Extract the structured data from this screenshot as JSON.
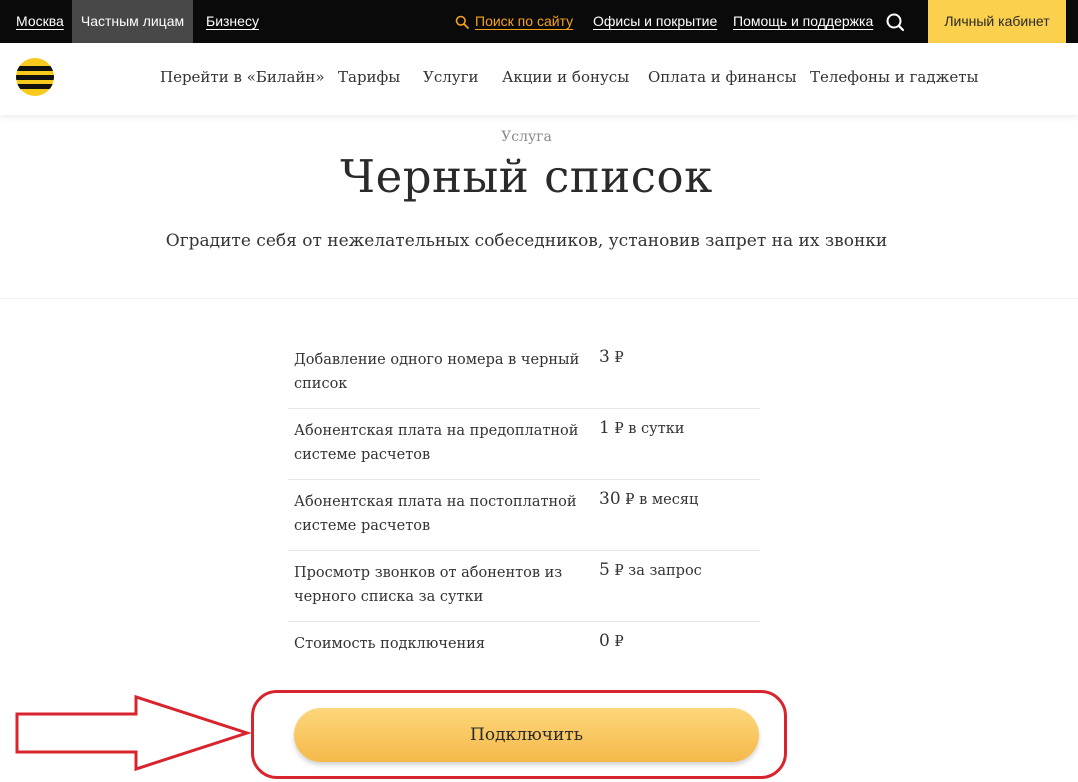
{
  "topbar": {
    "city": "Москва",
    "private": "Частным лицам",
    "business": "Бизнесу",
    "search": "Поиск по сайту",
    "offices": "Офисы и покрытие",
    "help": "Помощь и поддержка",
    "cabinet": "Личный кабинет"
  },
  "nav": {
    "items": [
      "Перейти в «Билайн»",
      "Тарифы",
      "Услуги",
      "Акции и бонусы",
      "Оплата и финансы",
      "Телефоны и гаджеты"
    ]
  },
  "hero": {
    "eyebrow": "Услуга",
    "title": "Черный список",
    "subtitle": "Оградите себя от нежелательных собеседников, установив запрет на их звонки"
  },
  "prices": [
    {
      "label_line1": "Добавление одного номера в черный",
      "label_line2": "список",
      "amount": "3",
      "currency": "₽",
      "unit": ""
    },
    {
      "label_line1": "Абонентская плата на предоплатной",
      "label_line2": "системе расчетов",
      "amount": "1",
      "currency": "₽",
      "unit": "в сутки"
    },
    {
      "label_line1": "Абонентская плата на постоплатной",
      "label_line2": "системе расчетов",
      "amount": "30",
      "currency": "₽",
      "unit": "в месяц"
    },
    {
      "label_line1": "Просмотр звонков от абонентов из",
      "label_line2": "черного списка за сутки",
      "amount": "5",
      "currency": "₽",
      "unit": "за запрос"
    },
    {
      "label_line1": "Стоимость подключения",
      "label_line2": "",
      "amount": "0",
      "currency": "₽",
      "unit": ""
    }
  ],
  "actions": {
    "connect": "Подключить"
  },
  "colors": {
    "topbar": "#0a0a0a",
    "accent": "#fbd04c",
    "search_link": "#f6a21a",
    "annotation": "#d8242c"
  },
  "icons": {
    "logo": "beeline-logo",
    "search": "search-icon",
    "arrow": "annotation-arrow"
  }
}
